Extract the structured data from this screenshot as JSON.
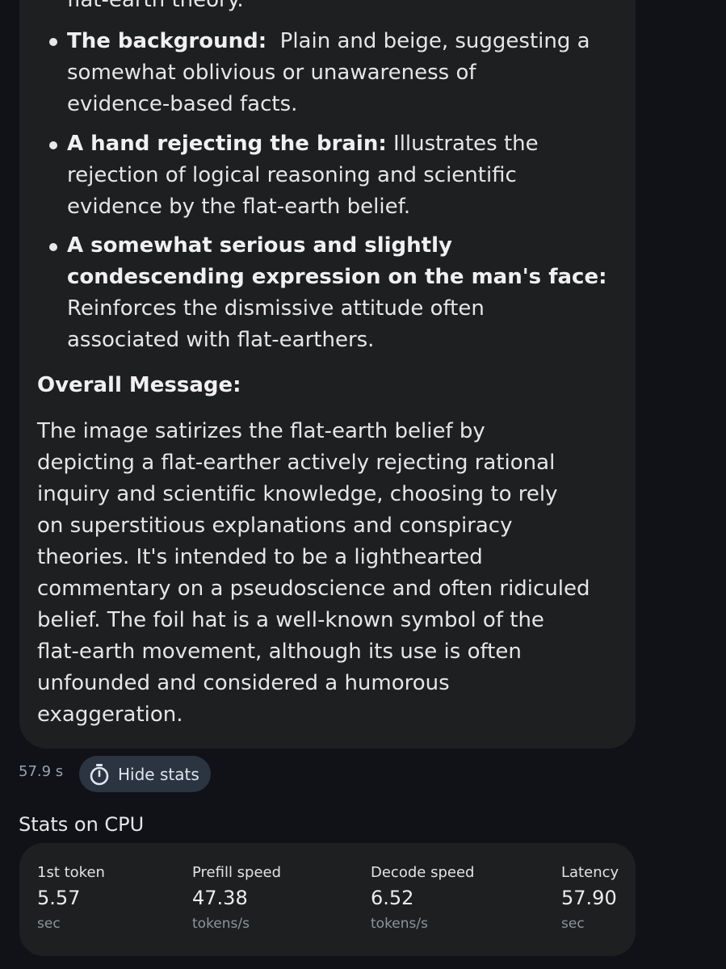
{
  "response": {
    "top_fragment": "flat-earth theory.",
    "bullets": [
      {
        "bold": "The background:",
        "lines": [
          "  Plain and beige, suggesting a",
          "somewhat oblivious or unawareness of",
          "evidence-based facts."
        ]
      },
      {
        "bold": "A hand rejecting the brain:",
        "lines": [
          " Illustrates the",
          "rejection of logical reasoning and scientific",
          "evidence by the flat-earth belief."
        ]
      },
      {
        "bold_lines": [
          "A somewhat serious and slightly",
          "condescending expression on the man's face:"
        ],
        "lines": [
          "Reinforces the dismissive attitude often",
          "associated with flat-earthers."
        ]
      }
    ],
    "overall_heading": "Overall Message:",
    "overall_lines": [
      "The image satirizes the flat-earth belief by",
      "depicting a flat-earther actively rejecting rational",
      "inquiry and scientific knowledge, choosing to rely",
      "on superstitious explanations and conspiracy",
      "theories. It's intended to be a lighthearted",
      "commentary on a pseudoscience and often ridiculed",
      "belief. The foil hat is a well-known symbol of the",
      "flat-earth movement, although its use is often",
      "unfounded and considered a humorous",
      "exaggeration."
    ]
  },
  "footer": {
    "elapsed": "57.9 s",
    "hide_stats_label": "Hide stats",
    "icon": "stopwatch-icon"
  },
  "stats": {
    "heading": "Stats on CPU",
    "items": [
      {
        "label": "1st token",
        "value": "5.57",
        "unit": "sec"
      },
      {
        "label": "Prefill speed",
        "value": "47.38",
        "unit": "tokens/s"
      },
      {
        "label": "Decode speed",
        "value": "6.52",
        "unit": "tokens/s"
      },
      {
        "label": "Latency",
        "value": "57.90",
        "unit": "sec"
      }
    ]
  },
  "colors": {
    "background": "#101217",
    "bubble": "#1e1f21",
    "button": "#2b3441",
    "muted_text": "#8e949c"
  }
}
